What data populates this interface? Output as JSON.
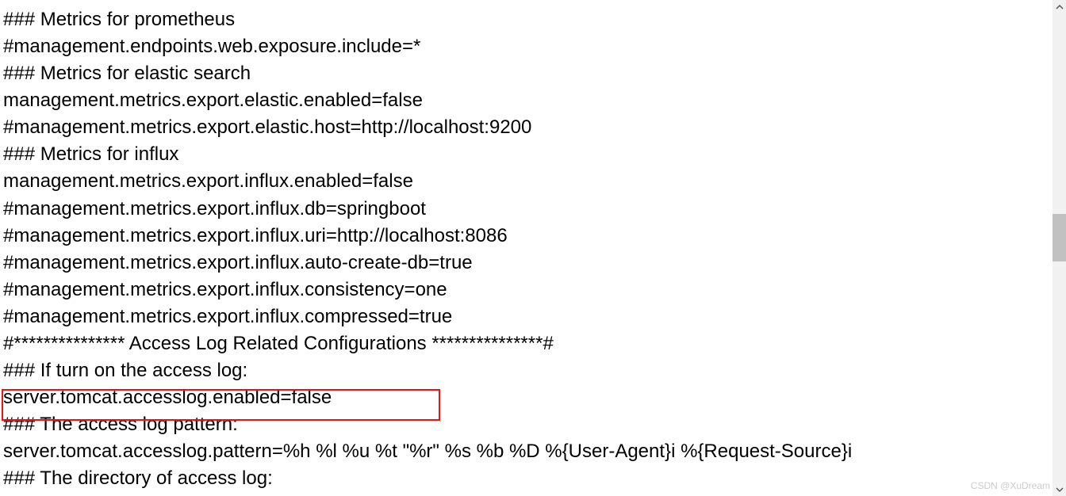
{
  "lines": [
    "### Metrics for prometheus",
    "#management.endpoints.web.exposure.include=*",
    "### Metrics for elastic search",
    "management.metrics.export.elastic.enabled=false",
    "#management.metrics.export.elastic.host=http://localhost:9200",
    "### Metrics for influx",
    "management.metrics.export.influx.enabled=false",
    "#management.metrics.export.influx.db=springboot",
    "#management.metrics.export.influx.uri=http://localhost:8086",
    "#management.metrics.export.influx.auto-create-db=true",
    "#management.metrics.export.influx.consistency=one",
    "#management.metrics.export.influx.compressed=true",
    "#*************** Access Log Related Configurations ***************#",
    "### If turn on the access log:",
    "server.tomcat.accesslog.enabled=false",
    "### The access log pattern:",
    "server.tomcat.accesslog.pattern=%h %l %u %t \"%r\" %s %b %D %{User-Agent}i %{Request-Source}i",
    "### The directory of access log:"
  ],
  "watermark": "CSDN @XuDream"
}
